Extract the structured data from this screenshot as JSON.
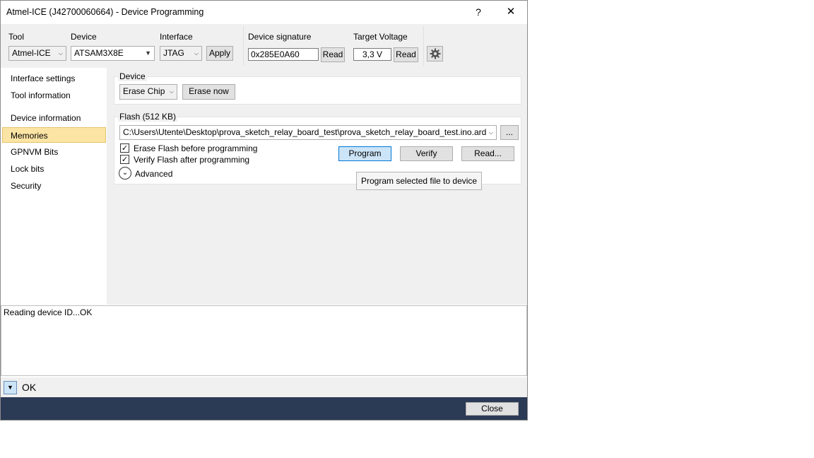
{
  "window": {
    "title": "Atmel-ICE (J42700060664) - Device Programming",
    "help_label": "?",
    "close_label": "✕"
  },
  "toolbar": {
    "tool_label": "Tool",
    "tool_value": "Atmel-ICE",
    "device_label": "Device",
    "device_value": "ATSAM3X8E",
    "interface_label": "Interface",
    "interface_value": "JTAG",
    "apply_label": "Apply",
    "signature_label": "Device signature",
    "signature_value": "0x285E0A60",
    "signature_read_label": "Read",
    "voltage_label": "Target Voltage",
    "voltage_value": "3,3 V",
    "voltage_read_label": "Read",
    "settings_icon": "gear-icon"
  },
  "sidebar": {
    "items": [
      {
        "label": "Interface settings"
      },
      {
        "label": "Tool information"
      },
      {
        "label": "Device information"
      },
      {
        "label": "Memories",
        "selected": true
      },
      {
        "label": "GPNVM Bits"
      },
      {
        "label": "Lock bits"
      },
      {
        "label": "Security"
      }
    ]
  },
  "device_group": {
    "label": "Device",
    "erase_mode_value": "Erase Chip",
    "erase_now_label": "Erase now"
  },
  "flash_group": {
    "label": "Flash (512 KB)",
    "file_path": "C:\\Users\\Utente\\Desktop\\prova_sketch_relay_board_test\\prova_sketch_relay_board_test.ino.ardui",
    "browse_label": "...",
    "erase_before_label": "Erase Flash before programming",
    "erase_before_checked": true,
    "verify_after_label": "Verify Flash after programming",
    "verify_after_checked": true,
    "program_label": "Program",
    "verify_label": "Verify",
    "read_label": "Read...",
    "advanced_label": "Advanced",
    "tooltip": "Program selected file to device"
  },
  "log": {
    "text": "Reading device ID...OK"
  },
  "status": {
    "text": "OK"
  },
  "footer": {
    "close_label": "Close"
  },
  "colors": {
    "selected_bg": "#fce4a5",
    "footer_bg": "#2b3a55",
    "active_button": "#cce4f7"
  }
}
